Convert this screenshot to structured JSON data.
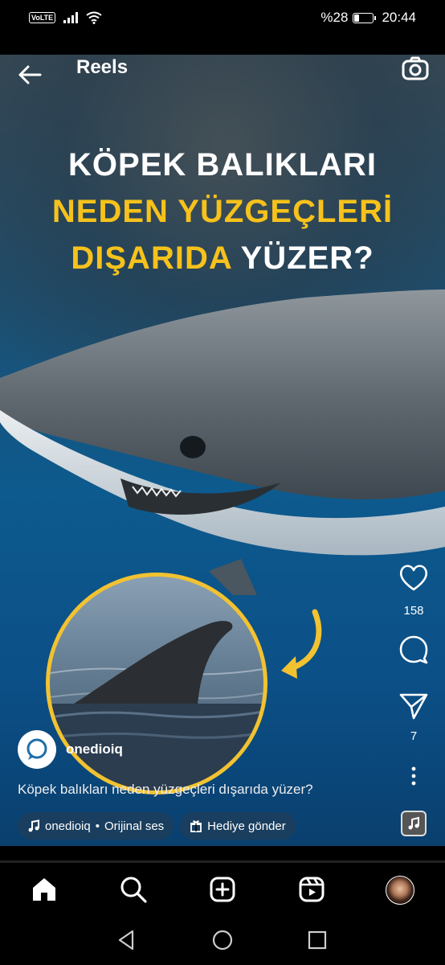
{
  "status_bar": {
    "volte": "VoLTE",
    "battery_text": "%28",
    "battery_level": 0.28,
    "time": "20:44"
  },
  "header": {
    "title": "Reels",
    "back_icon": "arrow-left-icon",
    "camera_icon": "camera-icon"
  },
  "video": {
    "headline_line1": "KÖPEK BALIKLARI",
    "headline_line2": "NEDEN YÜZGEÇLERİ",
    "headline_line3_yellow": "DIŞARIDA",
    "headline_line3_white": "YÜZER?",
    "accent_color": "#f6c21b"
  },
  "actions": {
    "like_count": "158",
    "share_count": "7"
  },
  "post": {
    "author": "onedioiq",
    "caption": "Köpek balıkları neden yüzgeçleri dışarıda yüzer?",
    "audio_author": "onedioiq",
    "audio_separator": "•",
    "audio_title": "Orijinal ses",
    "gift_label": "Hediye gönder"
  },
  "bottom_nav": {
    "items": [
      "home-icon",
      "search-icon",
      "create-icon",
      "reels-icon",
      "profile-avatar"
    ]
  }
}
